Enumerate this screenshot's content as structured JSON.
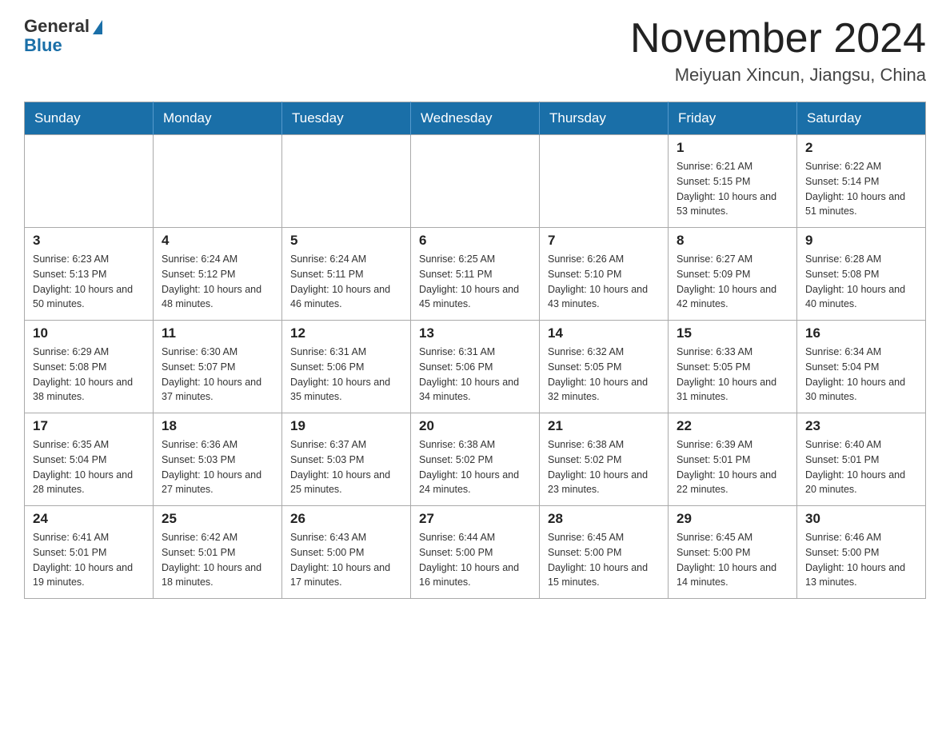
{
  "header": {
    "logo_general": "General",
    "logo_blue": "Blue",
    "month_title": "November 2024",
    "location": "Meiyuan Xincun, Jiangsu, China"
  },
  "weekdays": [
    "Sunday",
    "Monday",
    "Tuesday",
    "Wednesday",
    "Thursday",
    "Friday",
    "Saturday"
  ],
  "weeks": [
    [
      {
        "day": "",
        "info": ""
      },
      {
        "day": "",
        "info": ""
      },
      {
        "day": "",
        "info": ""
      },
      {
        "day": "",
        "info": ""
      },
      {
        "day": "",
        "info": ""
      },
      {
        "day": "1",
        "info": "Sunrise: 6:21 AM\nSunset: 5:15 PM\nDaylight: 10 hours and 53 minutes."
      },
      {
        "day": "2",
        "info": "Sunrise: 6:22 AM\nSunset: 5:14 PM\nDaylight: 10 hours and 51 minutes."
      }
    ],
    [
      {
        "day": "3",
        "info": "Sunrise: 6:23 AM\nSunset: 5:13 PM\nDaylight: 10 hours and 50 minutes."
      },
      {
        "day": "4",
        "info": "Sunrise: 6:24 AM\nSunset: 5:12 PM\nDaylight: 10 hours and 48 minutes."
      },
      {
        "day": "5",
        "info": "Sunrise: 6:24 AM\nSunset: 5:11 PM\nDaylight: 10 hours and 46 minutes."
      },
      {
        "day": "6",
        "info": "Sunrise: 6:25 AM\nSunset: 5:11 PM\nDaylight: 10 hours and 45 minutes."
      },
      {
        "day": "7",
        "info": "Sunrise: 6:26 AM\nSunset: 5:10 PM\nDaylight: 10 hours and 43 minutes."
      },
      {
        "day": "8",
        "info": "Sunrise: 6:27 AM\nSunset: 5:09 PM\nDaylight: 10 hours and 42 minutes."
      },
      {
        "day": "9",
        "info": "Sunrise: 6:28 AM\nSunset: 5:08 PM\nDaylight: 10 hours and 40 minutes."
      }
    ],
    [
      {
        "day": "10",
        "info": "Sunrise: 6:29 AM\nSunset: 5:08 PM\nDaylight: 10 hours and 38 minutes."
      },
      {
        "day": "11",
        "info": "Sunrise: 6:30 AM\nSunset: 5:07 PM\nDaylight: 10 hours and 37 minutes."
      },
      {
        "day": "12",
        "info": "Sunrise: 6:31 AM\nSunset: 5:06 PM\nDaylight: 10 hours and 35 minutes."
      },
      {
        "day": "13",
        "info": "Sunrise: 6:31 AM\nSunset: 5:06 PM\nDaylight: 10 hours and 34 minutes."
      },
      {
        "day": "14",
        "info": "Sunrise: 6:32 AM\nSunset: 5:05 PM\nDaylight: 10 hours and 32 minutes."
      },
      {
        "day": "15",
        "info": "Sunrise: 6:33 AM\nSunset: 5:05 PM\nDaylight: 10 hours and 31 minutes."
      },
      {
        "day": "16",
        "info": "Sunrise: 6:34 AM\nSunset: 5:04 PM\nDaylight: 10 hours and 30 minutes."
      }
    ],
    [
      {
        "day": "17",
        "info": "Sunrise: 6:35 AM\nSunset: 5:04 PM\nDaylight: 10 hours and 28 minutes."
      },
      {
        "day": "18",
        "info": "Sunrise: 6:36 AM\nSunset: 5:03 PM\nDaylight: 10 hours and 27 minutes."
      },
      {
        "day": "19",
        "info": "Sunrise: 6:37 AM\nSunset: 5:03 PM\nDaylight: 10 hours and 25 minutes."
      },
      {
        "day": "20",
        "info": "Sunrise: 6:38 AM\nSunset: 5:02 PM\nDaylight: 10 hours and 24 minutes."
      },
      {
        "day": "21",
        "info": "Sunrise: 6:38 AM\nSunset: 5:02 PM\nDaylight: 10 hours and 23 minutes."
      },
      {
        "day": "22",
        "info": "Sunrise: 6:39 AM\nSunset: 5:01 PM\nDaylight: 10 hours and 22 minutes."
      },
      {
        "day": "23",
        "info": "Sunrise: 6:40 AM\nSunset: 5:01 PM\nDaylight: 10 hours and 20 minutes."
      }
    ],
    [
      {
        "day": "24",
        "info": "Sunrise: 6:41 AM\nSunset: 5:01 PM\nDaylight: 10 hours and 19 minutes."
      },
      {
        "day": "25",
        "info": "Sunrise: 6:42 AM\nSunset: 5:01 PM\nDaylight: 10 hours and 18 minutes."
      },
      {
        "day": "26",
        "info": "Sunrise: 6:43 AM\nSunset: 5:00 PM\nDaylight: 10 hours and 17 minutes."
      },
      {
        "day": "27",
        "info": "Sunrise: 6:44 AM\nSunset: 5:00 PM\nDaylight: 10 hours and 16 minutes."
      },
      {
        "day": "28",
        "info": "Sunrise: 6:45 AM\nSunset: 5:00 PM\nDaylight: 10 hours and 15 minutes."
      },
      {
        "day": "29",
        "info": "Sunrise: 6:45 AM\nSunset: 5:00 PM\nDaylight: 10 hours and 14 minutes."
      },
      {
        "day": "30",
        "info": "Sunrise: 6:46 AM\nSunset: 5:00 PM\nDaylight: 10 hours and 13 minutes."
      }
    ]
  ]
}
